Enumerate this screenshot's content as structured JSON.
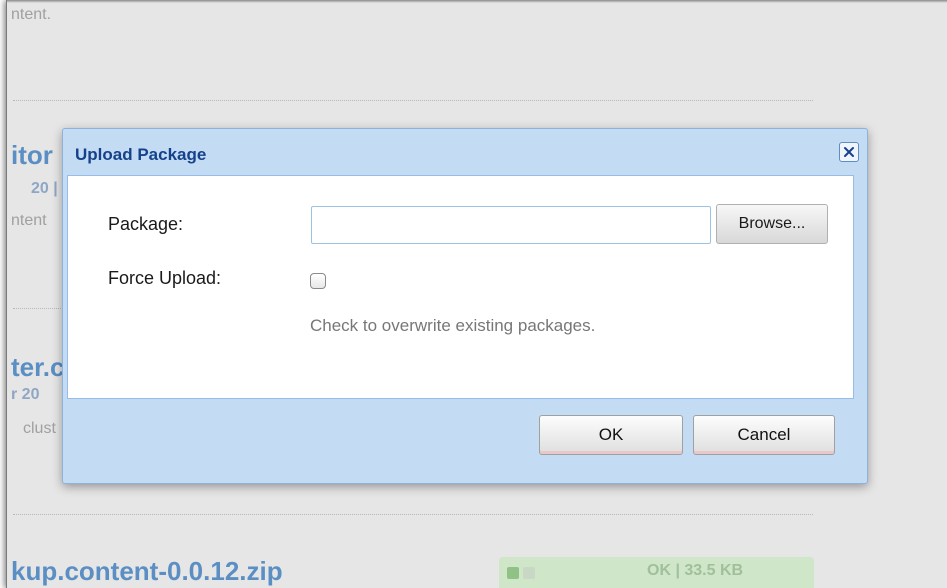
{
  "background": {
    "line1": "ntent.",
    "item1_title": "itor",
    "item1_meta": "20 |",
    "item1_desc": "ntent",
    "item2_title": "ter.c",
    "item2_meta": "r 20",
    "item2_desc": "clust",
    "item3_title": "kup.content-0.0.12.zip",
    "item3_status": "OK | 33.5 KB"
  },
  "dialog": {
    "title": "Upload Package",
    "package_label": "Package:",
    "package_value": "",
    "browse_label": "Browse...",
    "force_label": "Force Upload:",
    "force_checked": false,
    "force_hint": "Check to overwrite existing packages.",
    "ok_label": "OK",
    "cancel_label": "Cancel"
  },
  "colors": {
    "dialog_bg": "#c4dcf3",
    "title_color": "#15428b",
    "status_green": "#cfe6c8"
  },
  "icons": {
    "close": "close-icon"
  }
}
